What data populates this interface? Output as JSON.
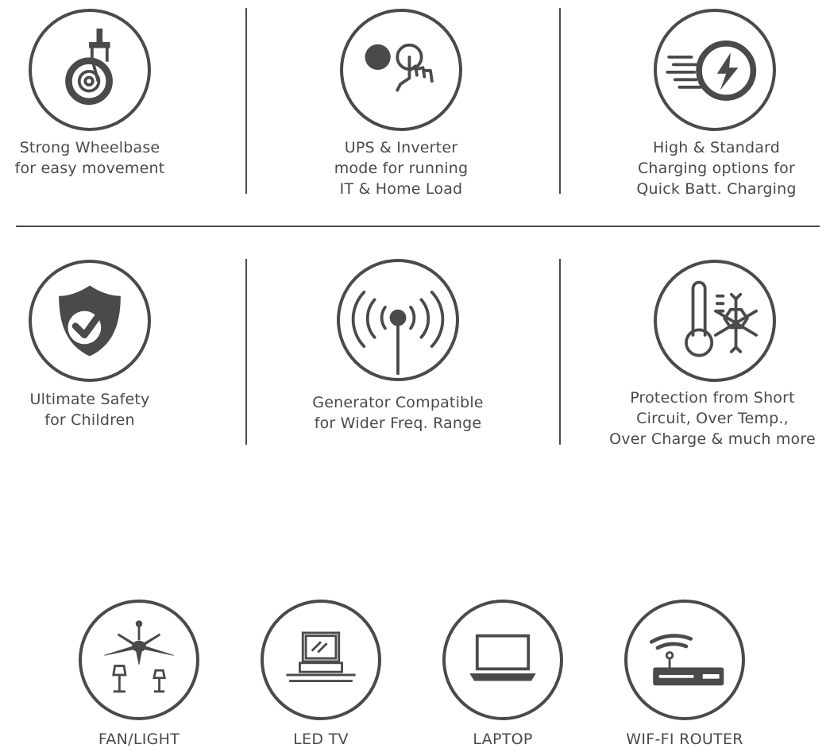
{
  "features": [
    {
      "icon": "caster-wheel-icon",
      "line1": "Strong Wheelbase",
      "line2": "for easy movement",
      "line3": ""
    },
    {
      "icon": "touch-button-icon",
      "line1": "UPS & Inverter",
      "line2": "mode for running",
      "line3": "IT & Home Load"
    },
    {
      "icon": "fast-charging-icon",
      "line1": "High & Standard",
      "line2": "Charging options for",
      "line3": "Quick Batt. Charging"
    },
    {
      "icon": "shield-check-icon",
      "line1": "Ultimate Safety",
      "line2": "for Children",
      "line3": ""
    },
    {
      "icon": "signal-antenna-icon",
      "line1": "Generator Compatible",
      "line2": "for Wider Freq. Range",
      "line3": ""
    },
    {
      "icon": "thermometer-snowflake-icon",
      "line1": "Protection from Short",
      "line2": "Circuit, Over Temp.,",
      "line3": "Over Charge & much more"
    }
  ],
  "devices": [
    {
      "icon": "fan-light-icon",
      "label": "FAN/LIGHT"
    },
    {
      "icon": "led-tv-icon",
      "label": "LED TV"
    },
    {
      "icon": "laptop-icon",
      "label": "LAPTOP"
    },
    {
      "icon": "wifi-router-icon",
      "label": "WIF-FI ROUTER"
    }
  ],
  "colors": {
    "icon": "#4a4a4a",
    "background": "#ffffff"
  }
}
